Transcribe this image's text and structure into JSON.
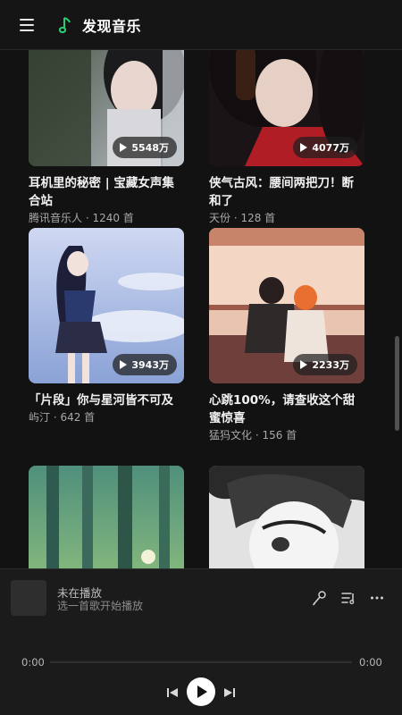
{
  "header": {
    "title": "发现音乐",
    "menu_icon": "hamburger-menu-icon",
    "logo_icon": "music-note-icon",
    "accent_color": "#2ecc71"
  },
  "playlists": [
    {
      "title": "耳机里的秘密 | 宝藏女声集合站",
      "meta": "腾讯音乐人 · 1240 首",
      "plays": "5548万"
    },
    {
      "title": "侠气古风：腰间两把刀！断和了",
      "meta": "天份 · 128 首",
      "plays": "4077万"
    },
    {
      "title": "「片段」你与星河皆不可及",
      "meta": "屿汀 · 642 首",
      "plays": "3943万"
    },
    {
      "title": "心跳100%，请查收这个甜蜜惊喜",
      "meta": "猛犸文化 · 156 首",
      "plays": "2233万"
    },
    {
      "title": "",
      "meta": "",
      "plays": ""
    },
    {
      "title": "",
      "meta": "",
      "plays": ""
    }
  ],
  "player": {
    "status": "未在播放",
    "hint": "选一首歌开始播放",
    "current_time": "0:00",
    "total_time": "0:00",
    "progress": 0,
    "icons": [
      "mic-icon",
      "playlist-icon",
      "more-icon",
      "previous-icon",
      "play-icon",
      "next-icon"
    ]
  }
}
